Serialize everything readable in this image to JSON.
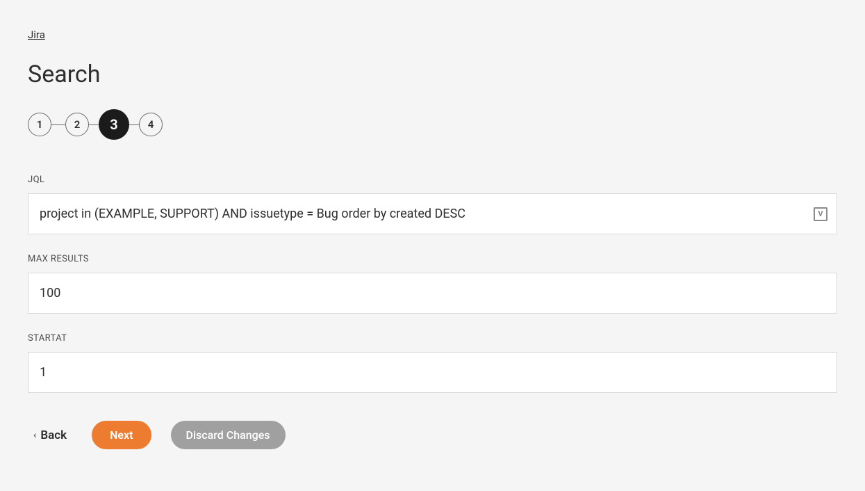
{
  "breadcrumb": {
    "label": "Jira"
  },
  "page": {
    "title": "Search"
  },
  "stepper": {
    "steps": [
      "1",
      "2",
      "3",
      "4"
    ],
    "active_index": 2
  },
  "fields": {
    "jql": {
      "label": "JQL",
      "value": "project in (EXAMPLE, SUPPORT) AND issuetype = Bug order by created DESC",
      "badge": "V"
    },
    "max_results": {
      "label": "MAX RESULTS",
      "value": "100"
    },
    "start_at": {
      "label": "STARTAT",
      "value": "1"
    }
  },
  "buttons": {
    "back": "Back",
    "next": "Next",
    "discard": "Discard Changes"
  }
}
